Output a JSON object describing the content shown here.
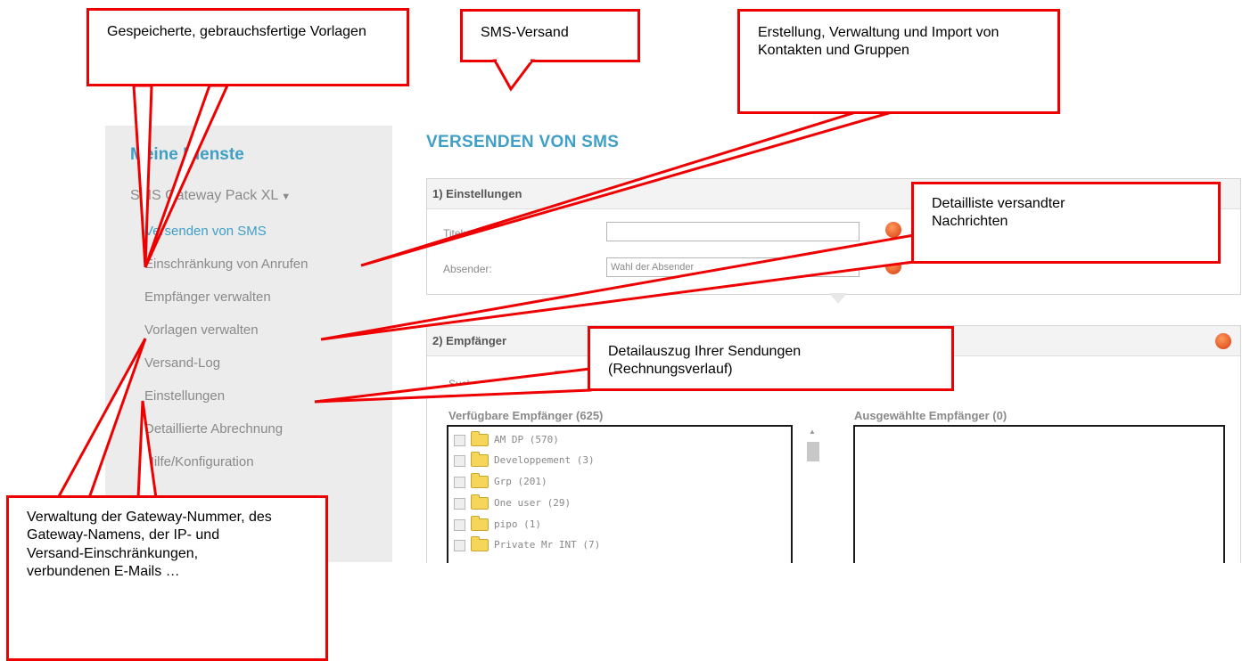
{
  "sidebar": {
    "title": "Meine Dienste",
    "group": "SMS Gateway Pack XL",
    "items": [
      {
        "label": "Versenden von SMS",
        "active": true
      },
      {
        "label": "Einschränkung von Anrufen"
      },
      {
        "label": "Empfänger verwalten"
      },
      {
        "label": "Vorlagen verwalten"
      },
      {
        "label": "Versand-Log"
      },
      {
        "label": "Einstellungen"
      },
      {
        "label": "Detaillierte Abrechnung"
      },
      {
        "label": "Hilfe/Konfiguration"
      }
    ]
  },
  "main": {
    "title": "VERSENDEN VON SMS",
    "settings": {
      "header": "1) Einstellungen",
      "title_label": "Titel:",
      "title_value": "",
      "sender_label": "Absender:",
      "sender_value": "Wahl der Absender"
    },
    "recipients": {
      "header": "2) Empfänger",
      "search_label": "Suchen:",
      "search_value": "",
      "available_label": "Verfügbare Empfänger (625)",
      "selected_label": "Ausgewählte Empfänger (0)",
      "groups": [
        "AM DP (570)",
        "Developpement (3)",
        "Grp (201)",
        "One user (29)",
        "pipo (1)",
        "Private Mr INT (7)"
      ]
    }
  },
  "callouts": {
    "templates": "Gespeicherte, gebrauchsfertige Vorlagen",
    "sms_send": "SMS-Versand",
    "contacts": "Erstellung, Verwaltung und Import von Kontakten und Gruppen",
    "log": "Detailliste versandter Nachrichten",
    "billing": "Detailauszug Ihrer Sendungen (Rechnungsverlauf)",
    "gateway": "Verwaltung der Gateway-Nummer, des Gateway-Namens, der IP- und Versand-Einschränkungen, verbundenen E-Mails …"
  },
  "colors": {
    "accent": "#3f9fc7",
    "callout_border": "#ee0000",
    "help_icon": "#e0531e"
  },
  "icons": {
    "help": "help-icon",
    "folder": "folder-icon",
    "caret": "chevron-down-icon"
  }
}
